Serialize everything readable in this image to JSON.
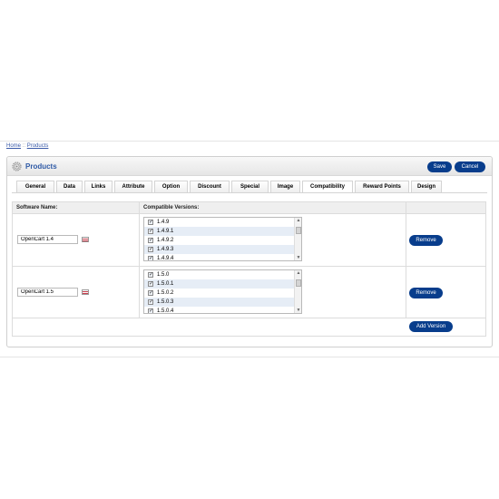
{
  "breadcrumb": {
    "home": "Home",
    "separator": "::",
    "current": "Products"
  },
  "header": {
    "title": "Products",
    "save_label": "Save",
    "cancel_label": "Cancel"
  },
  "tabs": [
    {
      "label": "General"
    },
    {
      "label": "Data"
    },
    {
      "label": "Links"
    },
    {
      "label": "Attribute"
    },
    {
      "label": "Option"
    },
    {
      "label": "Discount"
    },
    {
      "label": "Special"
    },
    {
      "label": "Image"
    },
    {
      "label": "Compatibility"
    },
    {
      "label": "Reward Points"
    },
    {
      "label": "Design"
    }
  ],
  "active_tab": "Compatibility",
  "table": {
    "col_software_name": "Software Name:",
    "col_compatible_versions": "Compatible Versions:",
    "rows": [
      {
        "name_value": "OpenCart 1.4",
        "versions": [
          "1.4.9",
          "1.4.9.1",
          "1.4.9.2",
          "1.4.9.3",
          "1.4.9.4"
        ],
        "remove_label": "Remove"
      },
      {
        "name_value": "OpenCart 1.5",
        "versions": [
          "1.5.0",
          "1.5.0.1",
          "1.5.0.2",
          "1.5.0.3",
          "1.5.0.4"
        ],
        "remove_label": "Remove"
      }
    ],
    "add_label": "Add Version"
  },
  "colors": {
    "button": "#083d8c",
    "title": "#2f5aa6",
    "row_highlight": "#e6edf6"
  }
}
